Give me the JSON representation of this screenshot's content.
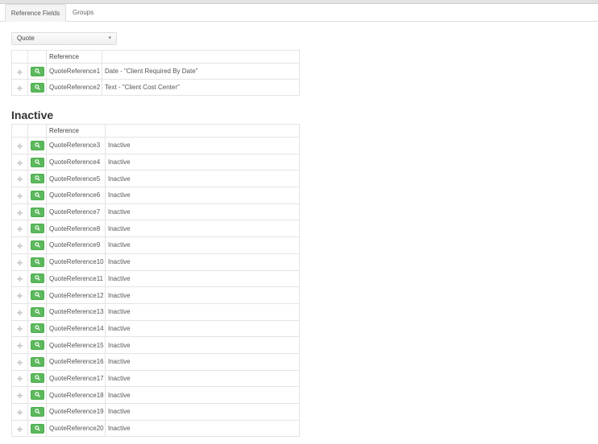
{
  "tabs": [
    {
      "label": "Reference Fields"
    },
    {
      "label": "Groups"
    }
  ],
  "entity_select": {
    "value": "Quote"
  },
  "active_table": {
    "header": {
      "reference": "Reference",
      "value": ""
    },
    "rows": [
      {
        "reference": "QuoteReference1",
        "value": "Date - \"Client Required By Date\""
      },
      {
        "reference": "QuoteReference2",
        "value": "Text - \"Client Cost Center\""
      }
    ]
  },
  "inactive_section": {
    "title": "Inactive"
  },
  "inactive_table": {
    "header": {
      "reference": "Reference",
      "value": ""
    },
    "rows": [
      {
        "reference": "QuoteReference3",
        "value": "Inactive"
      },
      {
        "reference": "QuoteReference4",
        "value": "Inactive"
      },
      {
        "reference": "QuoteReference5",
        "value": "Inactive"
      },
      {
        "reference": "QuoteReference6",
        "value": "Inactive"
      },
      {
        "reference": "QuoteReference7",
        "value": "Inactive"
      },
      {
        "reference": "QuoteReference8",
        "value": "Inactive"
      },
      {
        "reference": "QuoteReference9",
        "value": "Inactive"
      },
      {
        "reference": "QuoteReference10",
        "value": "Inactive"
      },
      {
        "reference": "QuoteReference11",
        "value": "Inactive"
      },
      {
        "reference": "QuoteReference12",
        "value": "Inactive"
      },
      {
        "reference": "QuoteReference13",
        "value": "Inactive"
      },
      {
        "reference": "QuoteReference14",
        "value": "Inactive"
      },
      {
        "reference": "QuoteReference15",
        "value": "Inactive"
      },
      {
        "reference": "QuoteReference16",
        "value": "Inactive"
      },
      {
        "reference": "QuoteReference17",
        "value": "Inactive"
      },
      {
        "reference": "QuoteReference18",
        "value": "Inactive"
      },
      {
        "reference": "QuoteReference19",
        "value": "Inactive"
      },
      {
        "reference": "QuoteReference20",
        "value": "Inactive"
      }
    ]
  },
  "icons": {
    "drag": "drag-handle-icon",
    "view": "magnifier-icon",
    "select_caret": "chevron-down-icon"
  },
  "colors": {
    "view_button": "#5cb85c",
    "tab_active_bg": "#f4f4f4",
    "border": "#e4e4e4"
  }
}
